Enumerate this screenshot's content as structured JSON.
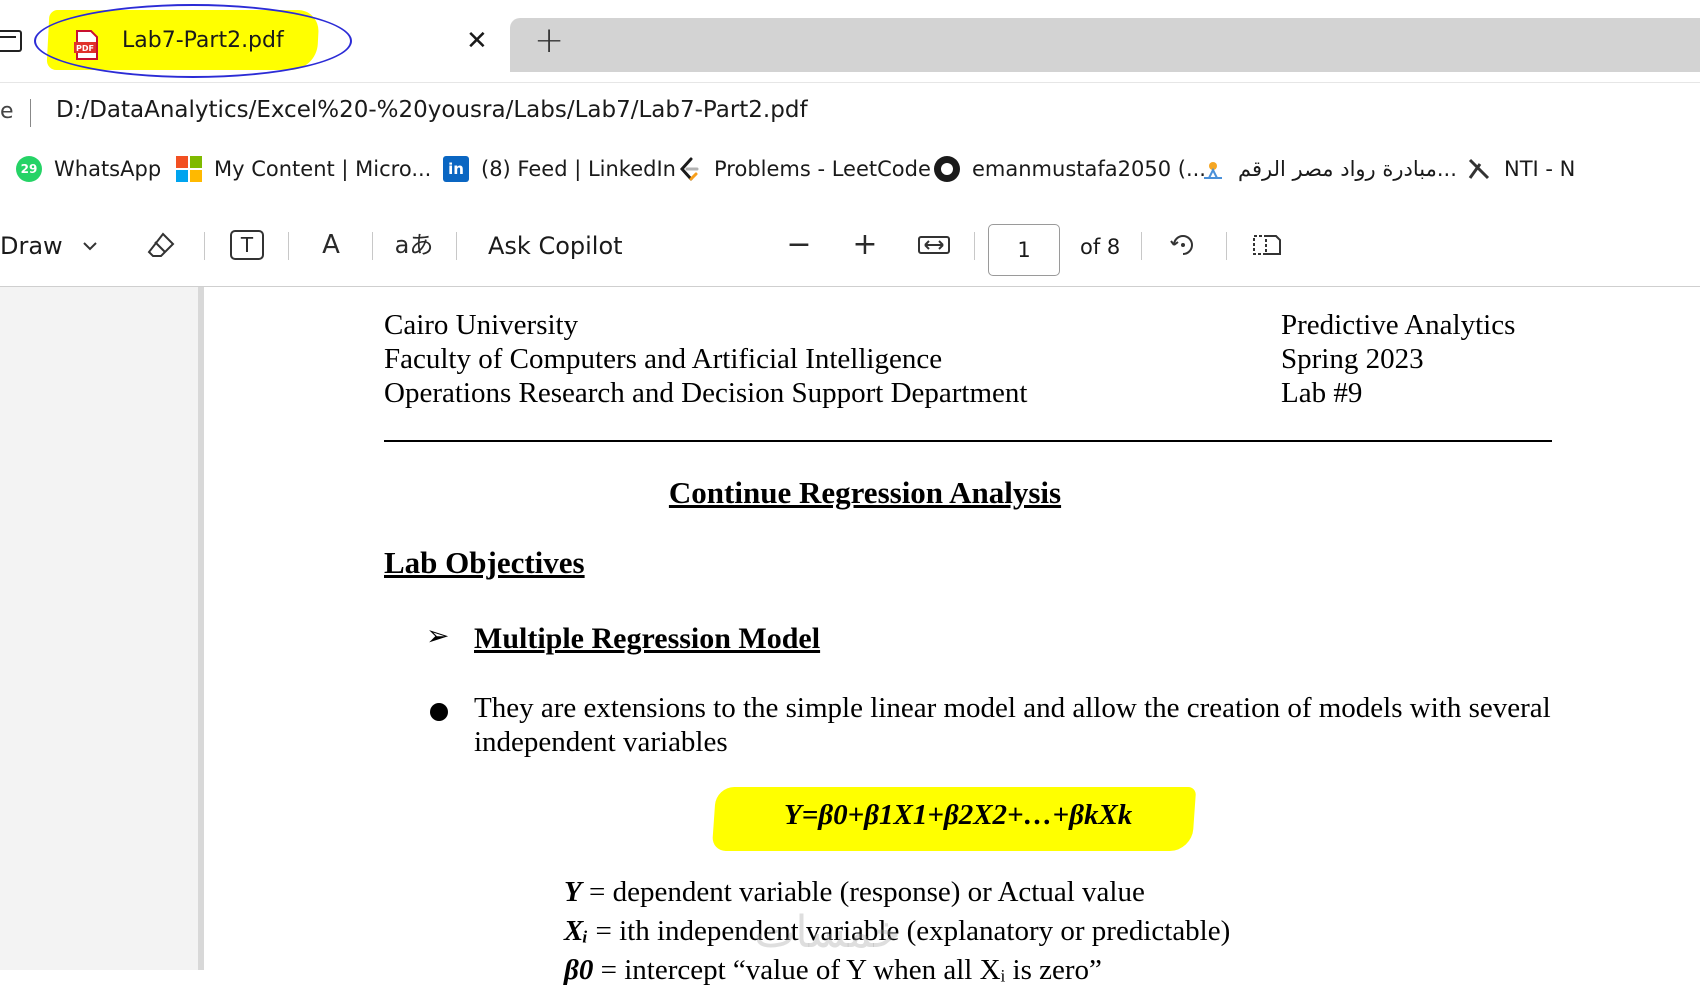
{
  "tab": {
    "title": "Lab7-Part2.pdf",
    "icon": "pdf-file-icon",
    "close_label": "✕",
    "new_tab_label": "+"
  },
  "address": {
    "left_fragment": "e",
    "url": "D:/DataAnalytics/Excel%20-%20yousra/Labs/Lab7/Lab7-Part2.pdf"
  },
  "bookmarks": [
    {
      "label": "WhatsApp",
      "icon": "whatsapp-icon",
      "badge": "29"
    },
    {
      "label": "My Content | Micro...",
      "icon": "microsoft-icon"
    },
    {
      "label": "(8) Feed | LinkedIn",
      "icon": "linkedin-icon",
      "badge": "in"
    },
    {
      "label": "Problems - LeetCode",
      "icon": "leetcode-icon"
    },
    {
      "label": "emanmustafa2050 (...",
      "icon": "github-icon"
    },
    {
      "label": "مبادرة رواد مصر الرقم...",
      "icon": "digital-egypt-icon"
    },
    {
      "label": "NTI - N",
      "icon": "nti-icon"
    }
  ],
  "toolbar": {
    "draw_label": "Draw",
    "ask_copilot_label": "Ask Copilot",
    "page_current": "1",
    "page_total_label": "of 8",
    "text_icon_label": "T",
    "read_aloud_label": "A",
    "translate_label": "aあ",
    "zoom_out_label": "−",
    "zoom_in_label": "+"
  },
  "document": {
    "header_left": [
      "Cairo University",
      "Faculty of Computers and Artificial Intelligence",
      "Operations Research and Decision Support Department"
    ],
    "header_right": [
      "Predictive Analytics",
      "Spring 2023",
      "Lab #9"
    ],
    "title": "Continue Regression Analysis",
    "section_heading": "Lab Objectives",
    "subsection_heading": "Multiple Regression Model",
    "paragraph": "They are extensions to the simple linear model and allow the creation of models with several independent variables",
    "equation": "Y=β0+β1X1+β2X2+…+βkXk",
    "definitions": [
      {
        "symbol": "Y",
        "text": " = dependent variable (response) or Actual value"
      },
      {
        "symbol": "Xᵢ",
        "text": " = ith independent variable (explanatory or predictable)"
      },
      {
        "symbol": "β0",
        "text": " = intercept “value of Y when all Xᵢ is zero”"
      }
    ],
    "watermark": "خمسات"
  },
  "colors": {
    "highlight": "#ffff00",
    "annotation_circle": "#2b2bd6",
    "tabstrip_bg": "#d3d3d3"
  }
}
